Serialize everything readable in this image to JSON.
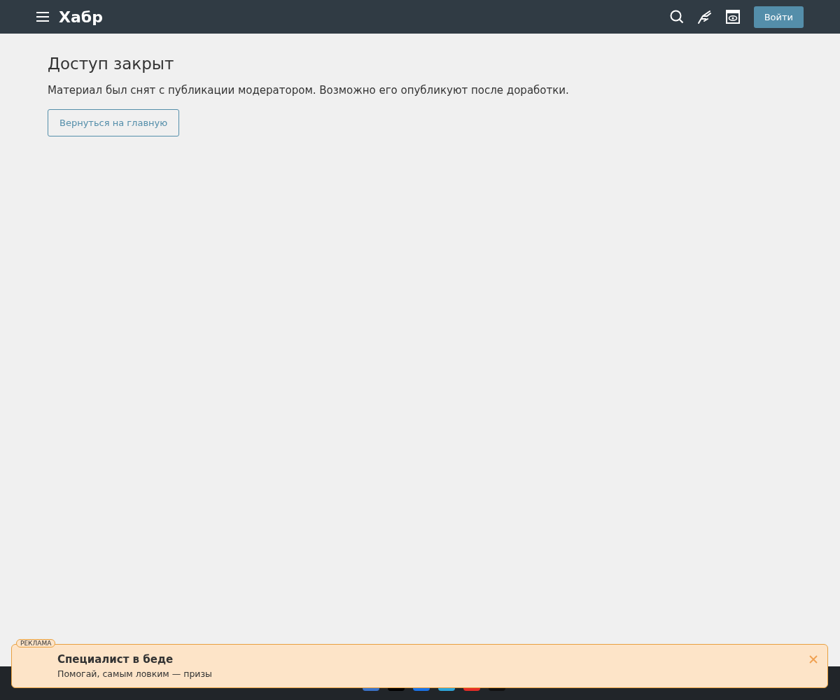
{
  "header": {
    "logo": "Хабр",
    "login_button": "Войти"
  },
  "content": {
    "title": "Доступ закрыт",
    "message": "Материал был снят с публикации модератором. Возможно его опубликуют после доработки.",
    "back_button": "Вернуться на главную"
  },
  "ad_banner": {
    "badge": "РЕКЛАМА",
    "title": "Специалист в беде",
    "subtitle": "Помогай, самым ловким — призы"
  }
}
